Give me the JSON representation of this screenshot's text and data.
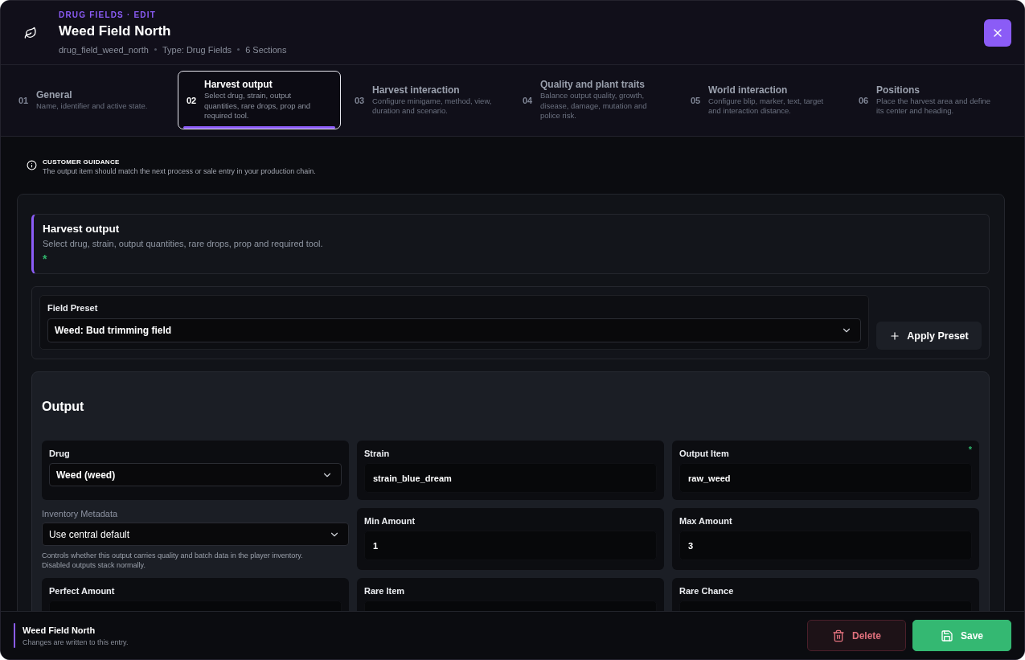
{
  "header": {
    "eyebrow": "DRUG FIELDS · EDIT",
    "title": "Weed Field North",
    "meta": [
      "drug_field_weed_north",
      "Type: Drug Fields",
      "6 Sections"
    ]
  },
  "steps": [
    {
      "number": "01",
      "title": "General",
      "description": "Name, identifier and active state.",
      "selected": false
    },
    {
      "number": "02",
      "title": "Harvest output",
      "description": "Select drug, strain, output quantities, rare drops, prop and required tool.",
      "selected": true
    },
    {
      "number": "03",
      "title": "Harvest interaction",
      "description": "Configure minigame, method, view, duration and scenario.",
      "selected": false
    },
    {
      "number": "04",
      "title": "Quality and plant traits",
      "description": "Balance output quality, growth, disease, damage, mutation and police risk.",
      "selected": false
    },
    {
      "number": "05",
      "title": "World interaction",
      "description": "Configure blip, marker, text, target and interaction distance.",
      "selected": false
    },
    {
      "number": "06",
      "title": "Positions",
      "description": "Place the harvest area and define its center and heading.",
      "selected": false
    }
  ],
  "guidance": {
    "title": "CUSTOMER GUIDANCE",
    "text": "The output item should match the next process or sale entry in your production chain."
  },
  "section": {
    "title": "Harvest output",
    "description": "Select drug, strain, output quantities, rare drops, prop and required tool.",
    "required_mark": "*"
  },
  "preset": {
    "label": "Field Preset",
    "value": "Weed: Bud trimming field",
    "button": "Apply Preset"
  },
  "output": {
    "title": "Output",
    "fields": [
      {
        "kind": "select",
        "label": "Drug",
        "value": "Weed (weed)"
      },
      {
        "kind": "input",
        "label": "Strain",
        "value": "strain_blue_dream"
      },
      {
        "kind": "input",
        "label": "Output Item",
        "value": "raw_weed",
        "required_mark": "*"
      },
      {
        "kind": "plain-select",
        "label": "Inventory Metadata",
        "value": "Use central default",
        "help": "Controls whether this output carries quality and batch data in the player inventory. Disabled outputs stack normally."
      },
      {
        "kind": "input",
        "label": "Min Amount",
        "value": "1"
      },
      {
        "kind": "input",
        "label": "Max Amount",
        "value": "3"
      },
      {
        "kind": "input",
        "label": "Perfect Amount"
      },
      {
        "kind": "input",
        "label": "Rare Item"
      },
      {
        "kind": "input",
        "label": "Rare Chance"
      }
    ]
  },
  "footer": {
    "title": "Weed Field North",
    "subtitle": "Changes are written to this entry.",
    "buttons": [
      {
        "kind": "delete",
        "label": "Delete"
      },
      {
        "kind": "save",
        "label": "Save"
      }
    ]
  }
}
